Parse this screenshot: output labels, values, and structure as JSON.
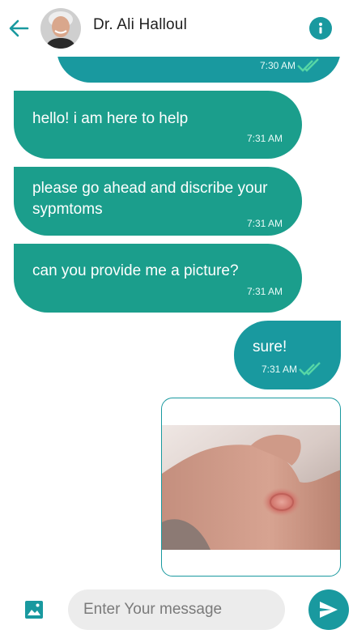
{
  "header": {
    "title": "Dr. Ali Halloul"
  },
  "icons": {
    "back": "arrow-left-icon",
    "info": "info-icon",
    "gallery": "image-icon",
    "send": "send-icon",
    "read_receipt": "double-check-icon"
  },
  "messages": [
    {
      "from": "me",
      "text": "",
      "time": "7:30 AM",
      "read": true
    },
    {
      "from": "doctor",
      "text": "hello! i am here to help",
      "time": "7:31 AM"
    },
    {
      "from": "doctor",
      "text": "please go ahead and discribe your sypmtoms",
      "time": "7:31 AM"
    },
    {
      "from": "doctor",
      "text": "can you provide me a picture?",
      "time": "7:31 AM"
    },
    {
      "from": "me",
      "text": "sure!",
      "time": "7:31 AM",
      "read": true
    },
    {
      "from": "me",
      "type": "image"
    }
  ],
  "composer": {
    "placeholder": "Enter Your message"
  },
  "colors": {
    "primary": "#19999f",
    "received": "#1b9e8c",
    "read_check": "#56d6a6",
    "input_bg": "#ececec"
  }
}
